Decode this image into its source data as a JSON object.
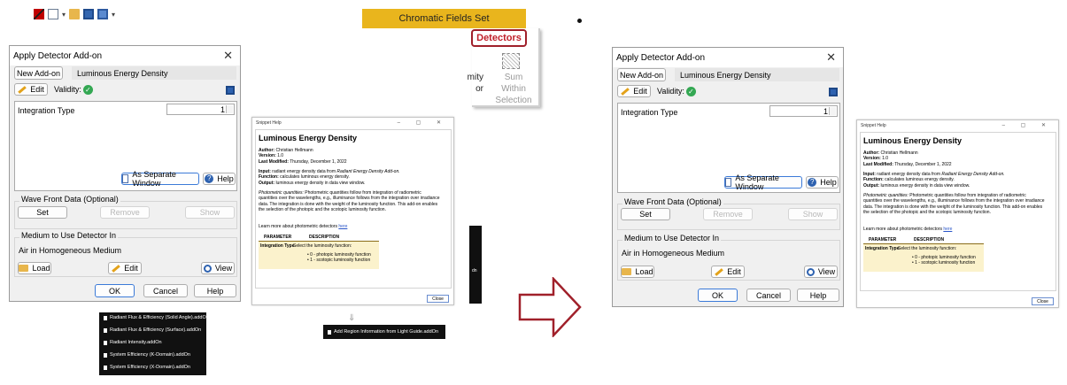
{
  "ribbon": {
    "tab_label": "Chromatic Fields Set",
    "detectors_label": "Detectors",
    "sum_within_line1": "Sum Within",
    "sum_within_line2": "Selection",
    "clipped_line1": "mity",
    "clipped_line2": "or"
  },
  "dialog": {
    "title": "Apply Detector Add-on",
    "new_addon_label": "New Add-on",
    "addon_name": "Luminous Energy Density",
    "edit_label": "Edit",
    "validity_label": "Validity:",
    "integration_type_label": "Integration Type",
    "integration_type_value": "1",
    "separate_window_label": "As Separate Window",
    "help_label": "Help",
    "wavefront_title": "Wave Front Data (Optional)",
    "set_label": "Set",
    "remove_label": "Remove",
    "show_label": "Show",
    "medium_title": "Medium to Use Detector In",
    "medium_value": "Air in Homogeneous Medium",
    "load_label": "Load",
    "edit2_label": "Edit",
    "view_label": "View",
    "ok_label": "OK",
    "cancel_label": "Cancel",
    "help2_label": "Help"
  },
  "snippet_help": {
    "window_title": "Snippet Help",
    "heading": "Luminous Energy Density",
    "author_label": "Author:",
    "author": "Christian Hellmann",
    "version_label": "Version:",
    "version": "1.0",
    "modified_label": "Last Modified:",
    "modified": "Thursday, December 1, 2022",
    "input_label": "Input:",
    "input_text": "radiant energy density data from",
    "input_italic": "Radiant Energy Density Add-on.",
    "function_label": "Function:",
    "function_text": "calculates luminous energy density.",
    "output_label": "Output:",
    "output_text": "luminous energy density in data view window.",
    "desc_italic": "Photometric quantities:",
    "desc_line1": "Photometric quantities follow from integration of radiometric",
    "desc_line2": "quantities over the wavelengths, e.g., illuminance follows from the integration over irradiance",
    "desc_line3": "data. The integration is done with the weight of the luminosity function. This add-on enables",
    "desc_line4": "the selection of the photopic and the scotopic luminosity function.",
    "learn_more": "Learn more about photometric detectors",
    "learn_more_link": "here",
    "table_col1": "PARAMETER",
    "table_col2": "DESCRIPTION",
    "param_name": "Integration Type",
    "param_desc": "Select the luminosity function:",
    "param_opt1": "0 - photopic luminosity function",
    "param_opt2": "1 - scotopic luminosity function",
    "close_label": "Close"
  },
  "file_list": [
    "Radiant Flux & Efficiency (Solid Angle).addOn",
    "Radiant Flux & Efficiency (Surface).addOn",
    "Radiant Intensity.addOn",
    "System Efficiency (K-Domain).addOn",
    "System Efficiency (X-Domain).addOn"
  ],
  "region_file": "Add Region Information from Light Guide.addOn",
  "dark_strip_text": "dn",
  "colors": {
    "ribbon_tab": "#e9b51d",
    "detectors_accent": "#a0202a",
    "arrow": "#a0202a",
    "validity_ok": "#34a853"
  }
}
